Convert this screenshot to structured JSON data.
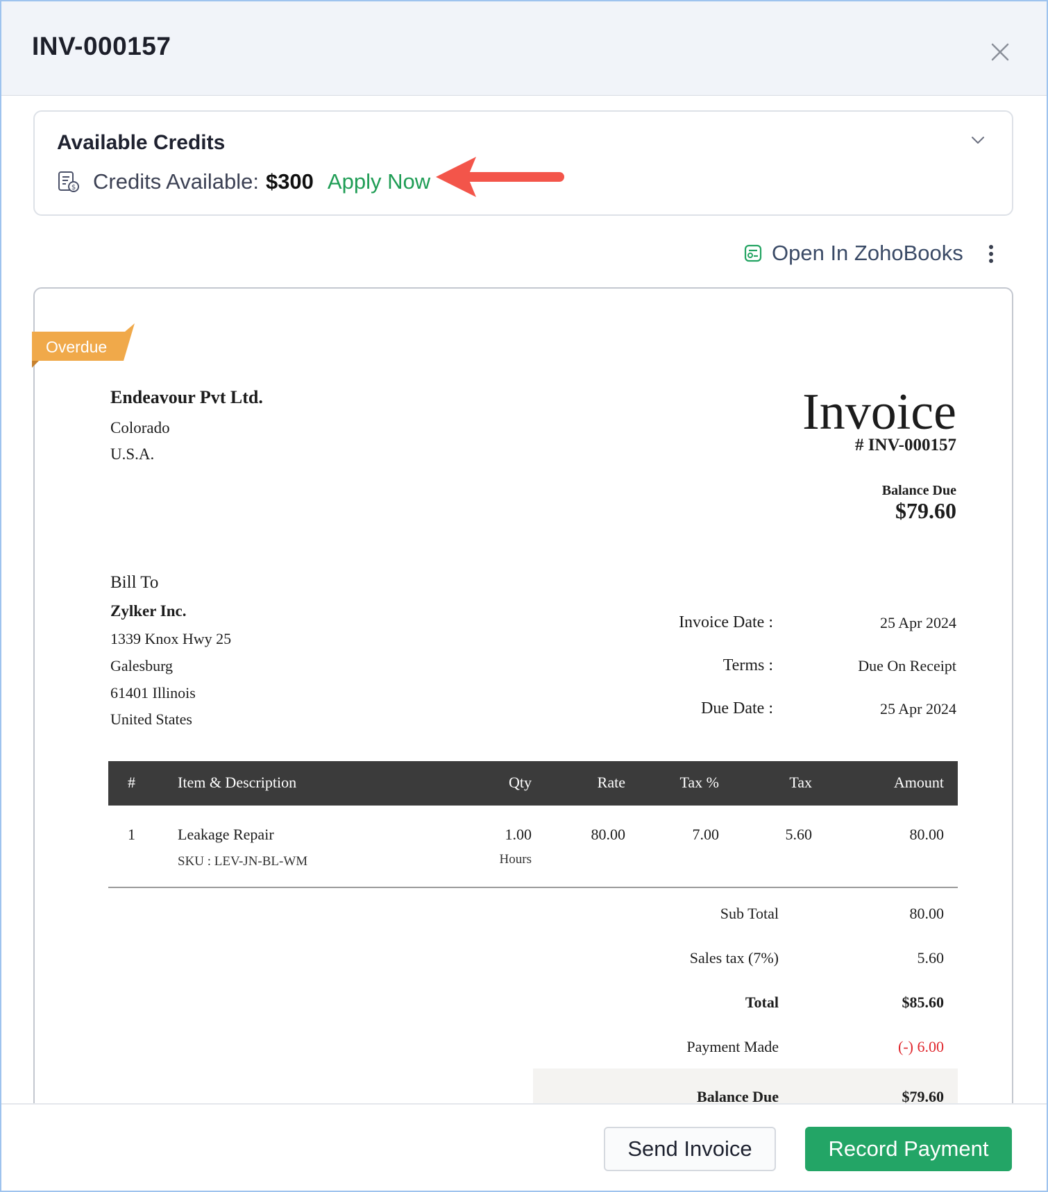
{
  "header": {
    "title": "INV-000157",
    "close_icon": "close-icon"
  },
  "credits": {
    "title": "Available Credits",
    "label": "Credits Available:",
    "amount": "$300",
    "apply_label": "Apply Now",
    "icon": "credits-receipt-icon",
    "annotation_color": "#f3554a"
  },
  "toolbar": {
    "open_label": "Open In ZohoBooks",
    "open_icon": "zohobooks-icon",
    "more_icon": "kebab-menu-icon"
  },
  "invoice": {
    "status_badge": "Overdue",
    "badge_color": "#f0a94a",
    "org": {
      "name": "Endeavour Pvt Ltd.",
      "lines": [
        "Colorado",
        "U.S.A."
      ]
    },
    "heading": "Invoice",
    "number": "# INV-000157",
    "balance_label": "Balance Due",
    "balance_value": "$79.60",
    "bill_to": {
      "label": "Bill To",
      "name": "Zylker Inc.",
      "lines": [
        "1339 Knox Hwy 25",
        "Galesburg",
        "61401 Illinois",
        "United States"
      ]
    },
    "meta": [
      {
        "label": "Invoice Date :",
        "value": "25 Apr 2024"
      },
      {
        "label": "Terms :",
        "value": "Due On Receipt"
      },
      {
        "label": "Due Date :",
        "value": "25 Apr 2024"
      }
    ],
    "table": {
      "headers": [
        "#",
        "Item & Description",
        "Qty",
        "Rate",
        "Tax %",
        "Tax",
        "Amount"
      ],
      "rows": [
        {
          "num": "1",
          "item": "Leakage Repair",
          "sku": "SKU : LEV-JN-BL-WM",
          "qty": "1.00",
          "unit": "Hours",
          "rate": "80.00",
          "tax_pct": "7.00",
          "tax": "5.60",
          "amount": "80.00"
        }
      ]
    },
    "totals": [
      {
        "label": "Sub Total",
        "value": "80.00"
      },
      {
        "label": "Sales tax (7%)",
        "value": "5.60"
      },
      {
        "label": "Total",
        "value": "$85.60"
      },
      {
        "label": "Payment Made",
        "value": "(-) 6.00"
      },
      {
        "label": "Balance Due",
        "value": "$79.60"
      }
    ]
  },
  "footer": {
    "send_label": "Send Invoice",
    "record_label": "Record Payment",
    "record_color": "#23a566"
  }
}
